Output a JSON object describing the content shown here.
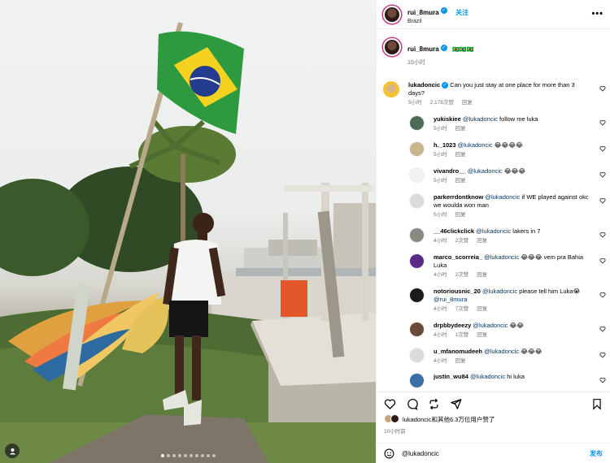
{
  "header": {
    "username": "rui_8mura",
    "follow_label": "关注",
    "location": "Brazil",
    "more_label": "•••"
  },
  "caption": {
    "username": "rui_8mura",
    "text": "🇧🇷🇧🇷🇧🇷",
    "time": "10小时"
  },
  "top_comment": {
    "username": "lukadoncic",
    "text": "Can you just stay at one place for more than 3 days?",
    "time": "5小时",
    "likes": "2,178次赞",
    "reply_label": "回复"
  },
  "replies": [
    {
      "username": "yukiskiee",
      "mention": "@lukadoncic",
      "text": "follow me luka",
      "time": "5小时",
      "likes": "",
      "reply_label": "回复",
      "avatar_color": "#4c6a5a"
    },
    {
      "username": "h._1023",
      "mention": "@lukadoncic",
      "text": "😂😂😂😂",
      "time": "5小时",
      "likes": "",
      "reply_label": "回复",
      "avatar_color": "#c9b68e"
    },
    {
      "username": "vivandro__",
      "mention": "@lukadoncic",
      "text": "😂😂😂",
      "time": "5小时",
      "likes": "",
      "reply_label": "回复",
      "avatar_color": "#f2f2f2"
    },
    {
      "username": "parkerrdontknow",
      "mention": "@lukadoncic",
      "text": "if WE played against okc we woulda won man",
      "time": "5小时",
      "likes": "",
      "reply_label": "回复",
      "avatar_color": "#dbdbdb"
    },
    {
      "username": "__46clickclick",
      "mention": "@lukadoncic",
      "text": "lakers in 7",
      "time": "4小时",
      "likes": "2次赞",
      "reply_label": "回复",
      "avatar_color": "#8a8a84"
    },
    {
      "username": "marco_scorreia_",
      "mention": "@lukadoncic",
      "text": "😂😂😂 vem pra Bahia Luka",
      "time": "4小时",
      "likes": "2次赞",
      "reply_label": "回复",
      "avatar_color": "#5b2a86"
    },
    {
      "username": "notoriousnic_20",
      "mention": "@lukadoncic",
      "text": "please tell him Luka😭",
      "mention2": "@rui_8mura",
      "time": "4小时",
      "likes": "7次赞",
      "reply_label": "回复",
      "avatar_color": "#1b1b1b"
    },
    {
      "username": "drpbbydeezy",
      "mention": "@lukadoncic",
      "text": "😂😂",
      "time": "4小时",
      "likes": "1次赞",
      "reply_label": "回复",
      "avatar_color": "#6a4b3a"
    },
    {
      "username": "u_mfanomudeeh",
      "mention": "@lukadoncic",
      "text": "😂😂😂",
      "time": "4小时",
      "likes": "",
      "reply_label": "回复",
      "avatar_color": "#dbdbdb"
    },
    {
      "username": "justin_wu84",
      "mention": "@lukadoncic",
      "text": "hi luka",
      "time": "",
      "likes": "",
      "reply_label": "",
      "avatar_color": "#3a6fa5"
    }
  ],
  "likes": {
    "text": "lukadoncic和其他6.3万位用户赞了"
  },
  "posted_time": "10小时前",
  "composer": {
    "value": "@lukadoncic",
    "post_label": "发布"
  },
  "colors": {
    "accent": "#0095f6",
    "mention": "#00376b",
    "muted": "#737373"
  },
  "carousel": {
    "count": 10,
    "active": 0
  }
}
